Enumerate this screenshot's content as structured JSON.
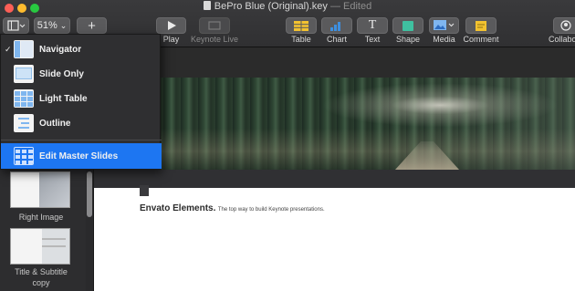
{
  "window": {
    "title": "BePro Blue (Original).key",
    "status": "— Edited"
  },
  "toolbar": {
    "zoom": "51%",
    "zoom_chevron": "⌄",
    "add_slide_symbol": "+",
    "play_label": "Play",
    "keynote_live_label": "Keynote Live",
    "table_label": "Table",
    "chart_label": "Chart",
    "text_label": "Text",
    "text_icon_symbol": "T",
    "shape_label": "Shape",
    "media_label": "Media",
    "comment_label": "Comment",
    "collaborate_label": "Collabo"
  },
  "view_menu": {
    "items": [
      {
        "label": "Navigator",
        "checked": true,
        "check_symbol": "✓",
        "icon": "navigator-view-icon"
      },
      {
        "label": "Slide Only",
        "icon": "slide-only-view-icon"
      },
      {
        "label": "Light Table",
        "icon": "light-table-view-icon"
      },
      {
        "label": "Outline",
        "icon": "outline-view-icon"
      },
      {
        "label": "Edit Master Slides",
        "selected": true,
        "icon": "edit-master-slides-icon"
      }
    ]
  },
  "navigator": {
    "thumbnails": [
      {
        "label": "Right Image"
      },
      {
        "label_line1": "Title & Subtitle",
        "label_line2": "copy"
      }
    ]
  },
  "slide": {
    "caption_bold": "Envato Elements.",
    "caption_small": "The top way to build Keynote presentations."
  },
  "colors": {
    "menu_selection": "#1d76f2",
    "toolbar_bg": "#3a3a3c",
    "close": "#fe5f57",
    "minimize": "#febc2e",
    "zoom": "#28c840",
    "table_icon": "#f2c230",
    "chart_icon": "#3d8fe0",
    "shape_icon": "#3fc0a0",
    "comment_icon": "#f2c230"
  }
}
